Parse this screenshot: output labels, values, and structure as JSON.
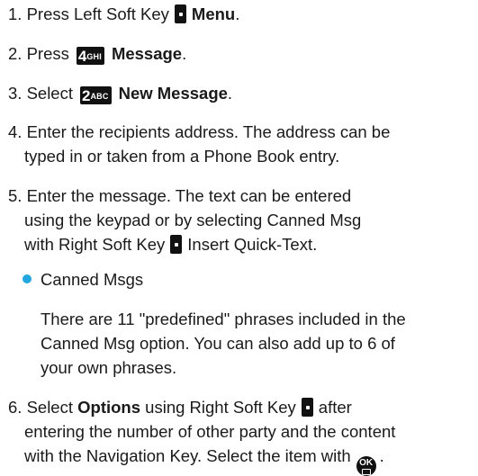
{
  "steps": {
    "s1": {
      "pre": "1. Press Left Soft Key",
      "bold": "Menu",
      "post": "."
    },
    "s2": {
      "pre": "2. Press",
      "key_num": "4",
      "key_letters": "GHI",
      "bold": "Message",
      "post": "."
    },
    "s3": {
      "pre": "3. Select",
      "key_num": "2",
      "key_letters": "ABC",
      "bold": "New Message",
      "post": "."
    },
    "s4": {
      "line1": "4. Enter the recipients address. The address can be",
      "line2": "typed in or taken from a Phone Book entry."
    },
    "s5": {
      "line1": "5. Enter the message. The text can be entered",
      "line2": "using the keypad or by selecting Canned Msg",
      "line3_pre": "with Right Soft Key",
      "line3_post": "Insert Quick-Text."
    },
    "bullet": {
      "label": "Canned Msgs",
      "line1": "There are 11 \"predefined\" phrases included in the",
      "line2": "Canned Msg option. You can also add up to 6 of",
      "line3": "your own phrases."
    },
    "s6": {
      "line1_pre": "6. Select",
      "line1_bold": "Options",
      "line1_mid": "using Right Soft Key",
      "line1_post": "after",
      "line2": "entering the number of other party and the content",
      "line3_pre": "with the Navigation Key. Select the item with",
      "line3_post": ".",
      "ok_label": "OK"
    }
  },
  "icons": {
    "soft_key": "soft-key-icon",
    "ok_key": "ok-key-icon",
    "bullet_color": "#23a7e0"
  }
}
